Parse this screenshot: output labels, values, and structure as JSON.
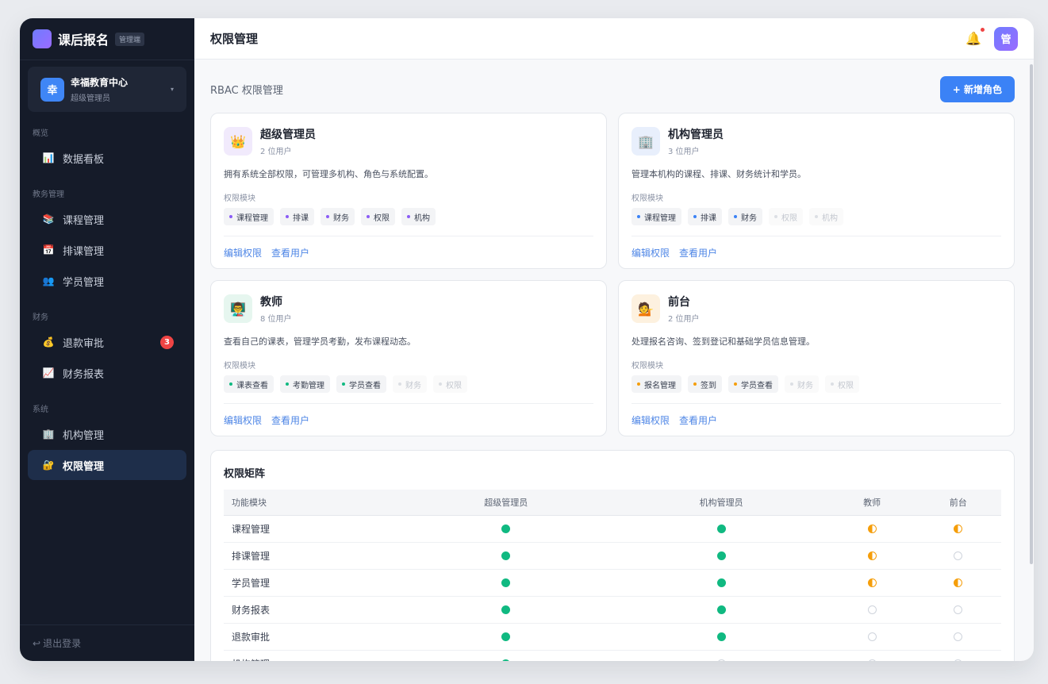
{
  "brand": {
    "name": "课后报名",
    "tag": "管理端"
  },
  "org": {
    "avatar": "幸",
    "name": "幸福教育中心",
    "role": "超级管理员",
    "caret": "▾"
  },
  "nav": {
    "sections": [
      {
        "title": "概览",
        "items": [
          {
            "icon": "📊",
            "label": "数据看板"
          }
        ]
      },
      {
        "title": "教务管理",
        "items": [
          {
            "icon": "📚",
            "label": "课程管理"
          },
          {
            "icon": "📅",
            "label": "排课管理"
          },
          {
            "icon": "👥",
            "label": "学员管理"
          }
        ]
      },
      {
        "title": "财务",
        "items": [
          {
            "icon": "💰",
            "label": "退款审批",
            "badge": "3"
          },
          {
            "icon": "📈",
            "label": "财务报表"
          }
        ]
      },
      {
        "title": "系统",
        "items": [
          {
            "icon": "🏢",
            "label": "机构管理"
          },
          {
            "icon": "🔐",
            "label": "权限管理",
            "active": true
          }
        ]
      }
    ],
    "logout": {
      "icon": "↩",
      "label": "退出登录"
    }
  },
  "topbar": {
    "title": "权限管理",
    "bell_icon": "🔔",
    "avatar": "管"
  },
  "content": {
    "subtitle": "RBAC 权限管理",
    "add_button": "+ 新增角色"
  },
  "roles": [
    {
      "icon": "👑",
      "icon_bg": "#f1eafc",
      "name": "超级管理员",
      "count": "2 位用户",
      "desc": "拥有系统全部权限，可管理多机构、角色与系统配置。",
      "modules_label": "权限模块",
      "dot_color": "#8b5cf6",
      "chips": [
        {
          "label": "课程管理",
          "on": true
        },
        {
          "label": "排课",
          "on": true
        },
        {
          "label": "财务",
          "on": true
        },
        {
          "label": "权限",
          "on": true
        },
        {
          "label": "机构",
          "on": true
        }
      ],
      "edit": "编辑权限",
      "view": "查看用户"
    },
    {
      "icon": "🏢",
      "icon_bg": "#e8effc",
      "name": "机构管理员",
      "count": "3 位用户",
      "desc": "管理本机构的课程、排课、财务统计和学员。",
      "modules_label": "权限模块",
      "dot_color": "#3b82f6",
      "chips": [
        {
          "label": "课程管理",
          "on": true
        },
        {
          "label": "排课",
          "on": true
        },
        {
          "label": "财务",
          "on": true
        },
        {
          "label": "权限",
          "on": false
        },
        {
          "label": "机构",
          "on": false
        }
      ],
      "edit": "编辑权限",
      "view": "查看用户"
    },
    {
      "icon": "👨‍🏫",
      "icon_bg": "#e6f6ef",
      "name": "教师",
      "count": "8 位用户",
      "desc": "查看自己的课表，管理学员考勤，发布课程动态。",
      "modules_label": "权限模块",
      "dot_color": "#10b981",
      "chips": [
        {
          "label": "课表查看",
          "on": true
        },
        {
          "label": "考勤管理",
          "on": true
        },
        {
          "label": "学员查看",
          "on": true
        },
        {
          "label": "财务",
          "on": false
        },
        {
          "label": "权限",
          "on": false
        }
      ],
      "edit": "编辑权限",
      "view": "查看用户"
    },
    {
      "icon": "💁",
      "icon_bg": "#fdf1df",
      "name": "前台",
      "count": "2 位用户",
      "desc": "处理报名咨询、签到登记和基础学员信息管理。",
      "modules_label": "权限模块",
      "dot_color": "#f59e0b",
      "chips": [
        {
          "label": "报名管理",
          "on": true
        },
        {
          "label": "签到",
          "on": true
        },
        {
          "label": "学员查看",
          "on": true
        },
        {
          "label": "财务",
          "on": false
        },
        {
          "label": "权限",
          "on": false
        }
      ],
      "edit": "编辑权限",
      "view": "查看用户"
    }
  ],
  "matrix": {
    "title": "权限矩阵",
    "columns": [
      "功能模块",
      "超级管理员",
      "机构管理员",
      "教师",
      "前台"
    ],
    "rows": [
      {
        "module": "课程管理",
        "levels": [
          "full",
          "full",
          "half",
          "half"
        ]
      },
      {
        "module": "排课管理",
        "levels": [
          "full",
          "full",
          "half",
          "none"
        ]
      },
      {
        "module": "学员管理",
        "levels": [
          "full",
          "full",
          "half",
          "half"
        ]
      },
      {
        "module": "财务报表",
        "levels": [
          "full",
          "full",
          "none",
          "none"
        ]
      },
      {
        "module": "退款审批",
        "levels": [
          "full",
          "full",
          "none",
          "none"
        ]
      },
      {
        "module": "机构管理",
        "levels": [
          "full",
          "none",
          "none",
          "none"
        ]
      }
    ]
  }
}
